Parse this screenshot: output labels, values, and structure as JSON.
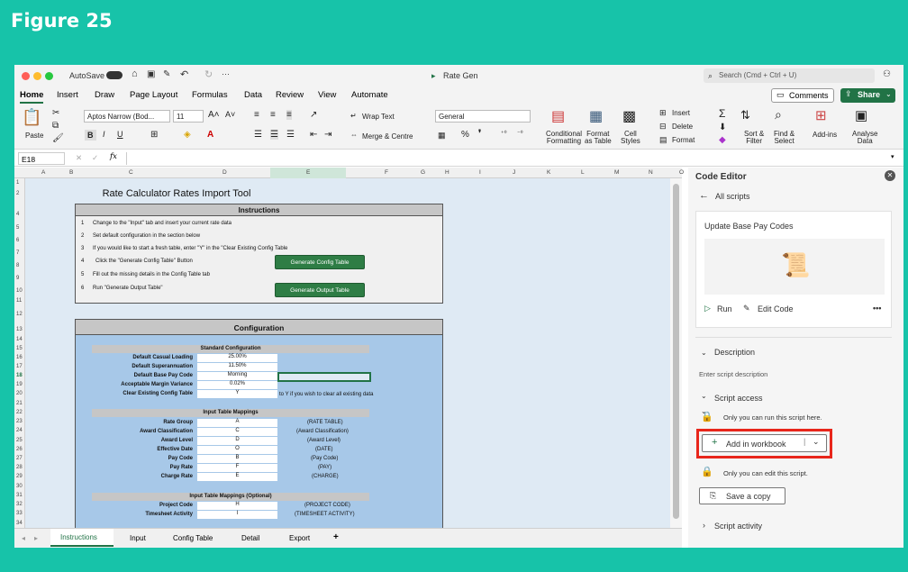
{
  "figure_title": "Figure 25",
  "titlebar": {
    "autosave": "AutoSave",
    "doc_name": "Rate Gen",
    "search_placeholder": "Search (Cmd + Ctrl + U)"
  },
  "ribbon_tabs": [
    "Home",
    "Insert",
    "Draw",
    "Page Layout",
    "Formulas",
    "Data",
    "Review",
    "View",
    "Automate"
  ],
  "comments_label": "Comments",
  "share_label": "Share",
  "ribbon": {
    "paste": "Paste",
    "font_name": "Aptos Narrow (Bod...",
    "font_size": "11",
    "wrap": "Wrap Text",
    "merge": "Merge & Centre",
    "number_format": "General",
    "cond": "Conditional\nFormatting",
    "fmt_table": "Format\nas Table",
    "cell_styles": "Cell\nStyles",
    "insert": "Insert",
    "delete": "Delete",
    "format": "Format",
    "sort": "Sort &\nFilter",
    "find": "Find &\nSelect",
    "addins": "Add-ins",
    "analyse": "Analyse\nData"
  },
  "formula_bar": {
    "cell_ref": "E18",
    "fx": "fx"
  },
  "columns": [
    "A",
    "B",
    "C",
    "D",
    "E",
    "F",
    "G",
    "H",
    "I",
    "J",
    "K",
    "L",
    "M",
    "N",
    "O"
  ],
  "sheet": {
    "title": "Rate Calculator Rates Import Tool",
    "instructions_header": "Instructions",
    "steps": [
      {
        "n": "1",
        "t": "Change to the \"Input\" tab and insert your current rate data"
      },
      {
        "n": "2",
        "t": "Set default configuration in the section below"
      },
      {
        "n": "3",
        "t": "If you would like to start a fresh table, enter \"Y\" in the \"Clear Existing Config Table"
      },
      {
        "n": "4",
        "t": "Click the \"Generate Config Table\" Button"
      },
      {
        "n": "5",
        "t": "Fill out the missing details in the Config Table tab"
      },
      {
        "n": "6",
        "t": "Run \"Generate Output Table\""
      }
    ],
    "gen_config_btn": "Generate Config Table",
    "gen_output_btn": "Generate Output Table",
    "config_header": "Configuration",
    "std_header": "Standard Configuration",
    "std_rows": [
      {
        "l": "Default Casual Loading",
        "v": "25.00%"
      },
      {
        "l": "Default Superannuation",
        "v": "11.50%"
      },
      {
        "l": "Default Base Pay Code",
        "v": "Morning"
      },
      {
        "l": "Acceptable Margin Variance",
        "v": "0.02%"
      },
      {
        "l": "Clear Existing Config Table",
        "v": "Y"
      }
    ],
    "clear_note": "to Y if you wish to clear all existing data",
    "map_header": "Input Table Mappings",
    "map_rows": [
      {
        "l": "Rate Group",
        "v": "A",
        "n": "(RATE TABLE)"
      },
      {
        "l": "Award Classification",
        "v": "C",
        "n": "(Award Classification)"
      },
      {
        "l": "Award Level",
        "v": "D",
        "n": "(Award Level)"
      },
      {
        "l": "Effective Date",
        "v": "O",
        "n": "(DATE)"
      },
      {
        "l": "Pay Code",
        "v": "B",
        "n": "(Pay Code)"
      },
      {
        "l": "Pay Rate",
        "v": "F",
        "n": "(PAY)"
      },
      {
        "l": "Charge Rate",
        "v": "E",
        "n": "(CHARGE)"
      }
    ],
    "opt_header": "Input Table Mappings (Optional)",
    "opt_rows": [
      {
        "l": "Project Code",
        "v": "H",
        "n": "(PROJECT CODE)"
      },
      {
        "l": "Timesheet Activity",
        "v": "I",
        "n": "(TIMESHEET ACTIVITY)"
      }
    ]
  },
  "sheet_tabs": [
    "Instructions",
    "Input",
    "Config Table",
    "Detail",
    "Export",
    "+"
  ],
  "pane": {
    "title": "Code Editor",
    "back": "All scripts",
    "script_name": "Update Base Pay Codes",
    "run": "Run",
    "edit": "Edit Code",
    "more": "•••",
    "description": "Description",
    "desc_placeholder": "Enter script description",
    "access": "Script access",
    "run_note": "Only you can run this script here.",
    "add_btn": "Add in workbook",
    "edit_note": "Only you can edit this script.",
    "save_copy": "Save a copy",
    "activity": "Script activity"
  },
  "colors": {
    "accent": "#17c3a9",
    "excel_green": "#217346",
    "highlight": "#e8261b"
  }
}
